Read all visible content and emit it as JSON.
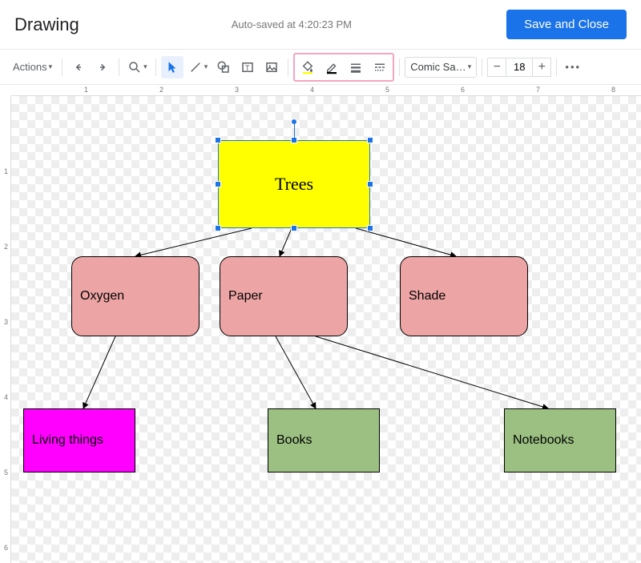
{
  "header": {
    "title": "Drawing",
    "autosave": "Auto-saved at 4:20:23 PM",
    "save_close_label": "Save and Close"
  },
  "toolbar": {
    "actions_label": "Actions",
    "font_name": "Comic San…",
    "font_size": "18"
  },
  "ruler": {
    "h": [
      "1",
      "2",
      "3",
      "4",
      "5",
      "6",
      "7",
      "8"
    ],
    "v": [
      "1",
      "2",
      "3",
      "4",
      "5",
      "6"
    ]
  },
  "shapes": {
    "trees": "Trees",
    "oxygen": "Oxygen",
    "paper": "Paper",
    "shade": "Shade",
    "living": "Living things",
    "books": "Books",
    "notebooks": "Notebooks"
  },
  "colors": {
    "accent": "#1a73e8",
    "highlight_border": "#f4a5c0",
    "trees_fill": "#ffff00",
    "pink_fill": "#eda4a4",
    "magenta_fill": "#ff00ff",
    "green_fill": "#9bc082"
  }
}
